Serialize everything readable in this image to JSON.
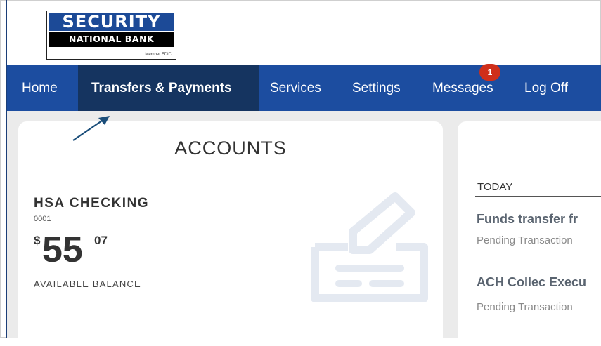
{
  "logo": {
    "line1": "SECURITY",
    "line2": "NATIONAL BANK",
    "line3": "Member FDIC"
  },
  "nav": {
    "items": [
      {
        "label": "Home"
      },
      {
        "label": "Transfers & Payments",
        "active": true
      },
      {
        "label": "Services"
      },
      {
        "label": "Settings"
      },
      {
        "label": "Messages"
      },
      {
        "label": "Log Off"
      }
    ],
    "messages_badge": "1"
  },
  "accounts": {
    "title": "ACCOUNTS",
    "account_name": "HSA CHECKING",
    "account_number": "0001",
    "currency_symbol": "$",
    "balance_dollars": "55",
    "balance_cents": "07",
    "balance_label": "AVAILABLE BALANCE"
  },
  "activity": {
    "section_label": "TODAY",
    "items": [
      {
        "title": "Funds transfer fr",
        "status": "Pending Transaction"
      },
      {
        "title": "ACH Collec Execu",
        "status": "Pending Transaction"
      }
    ]
  },
  "colors": {
    "nav_bg": "#1c4da0",
    "nav_active_bg": "#153460",
    "badge": "#cf2f1b",
    "content_bg": "#ebebeb"
  }
}
